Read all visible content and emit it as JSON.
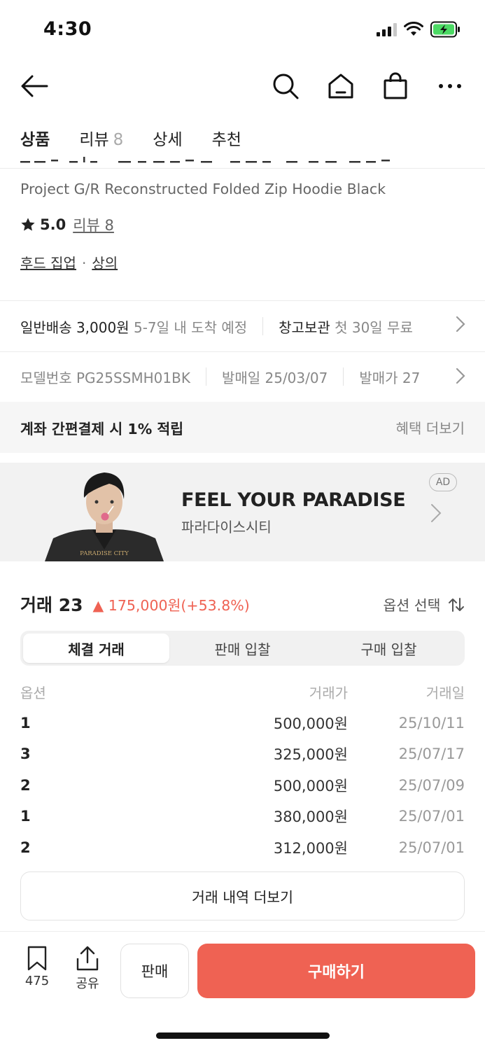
{
  "status": {
    "time": "4:30"
  },
  "tabs": [
    {
      "label": "상품"
    },
    {
      "label": "리뷰",
      "count": "8"
    },
    {
      "label": "상세"
    },
    {
      "label": "추천"
    }
  ],
  "product": {
    "en_title": "Project G/R Reconstructed Folded Zip Hoodie Black",
    "rating": "5.0",
    "review_link": "리뷰 8",
    "categories": [
      "후드 집업",
      "상의"
    ]
  },
  "shipping": {
    "label": "일반배송 3,000원",
    "eta": "5-7일 내 도착 예정",
    "storage_label": "창고보관",
    "storage_note": "첫 30일 무료"
  },
  "model_info": {
    "model_number": "모델번호 PG25SSMH01BK",
    "release_date": "발매일 25/03/07",
    "release_price": "발매가 27"
  },
  "benefit": {
    "text": "계좌 간편결제 시 1% 적립",
    "more": "혜택 더보기"
  },
  "ad": {
    "title": "FEEL YOUR PARADISE",
    "subtitle": "파라다이스시티",
    "badge": "AD",
    "photo_caption": "PARADISE CITY"
  },
  "trade": {
    "count_label": "거래 23",
    "change_label": "▲ 175,000원(+53.8%)",
    "option_select": "옵션 선택",
    "segments": [
      "체결 거래",
      "판매 입찰",
      "구매 입찰"
    ],
    "columns": [
      "옵션",
      "거래가",
      "거래일"
    ],
    "rows": [
      {
        "option": "1",
        "price": "500,000원",
        "date": "25/10/11"
      },
      {
        "option": "3",
        "price": "325,000원",
        "date": "25/07/17"
      },
      {
        "option": "2",
        "price": "500,000원",
        "date": "25/07/09"
      },
      {
        "option": "1",
        "price": "380,000원",
        "date": "25/07/01"
      },
      {
        "option": "2",
        "price": "312,000원",
        "date": "25/07/01"
      }
    ],
    "more_button": "거래 내역 더보기"
  },
  "bottom_bar": {
    "bookmark_count": "475",
    "share_label": "공유",
    "sell_label": "판매",
    "buy_label": "구매하기"
  },
  "colors": {
    "accent": "#ef6253",
    "battery": "#4cd964"
  },
  "icons": {
    "nav": [
      "back-arrow-icon",
      "search-icon",
      "home-icon",
      "shopping-bag-icon",
      "more-icon"
    ]
  }
}
